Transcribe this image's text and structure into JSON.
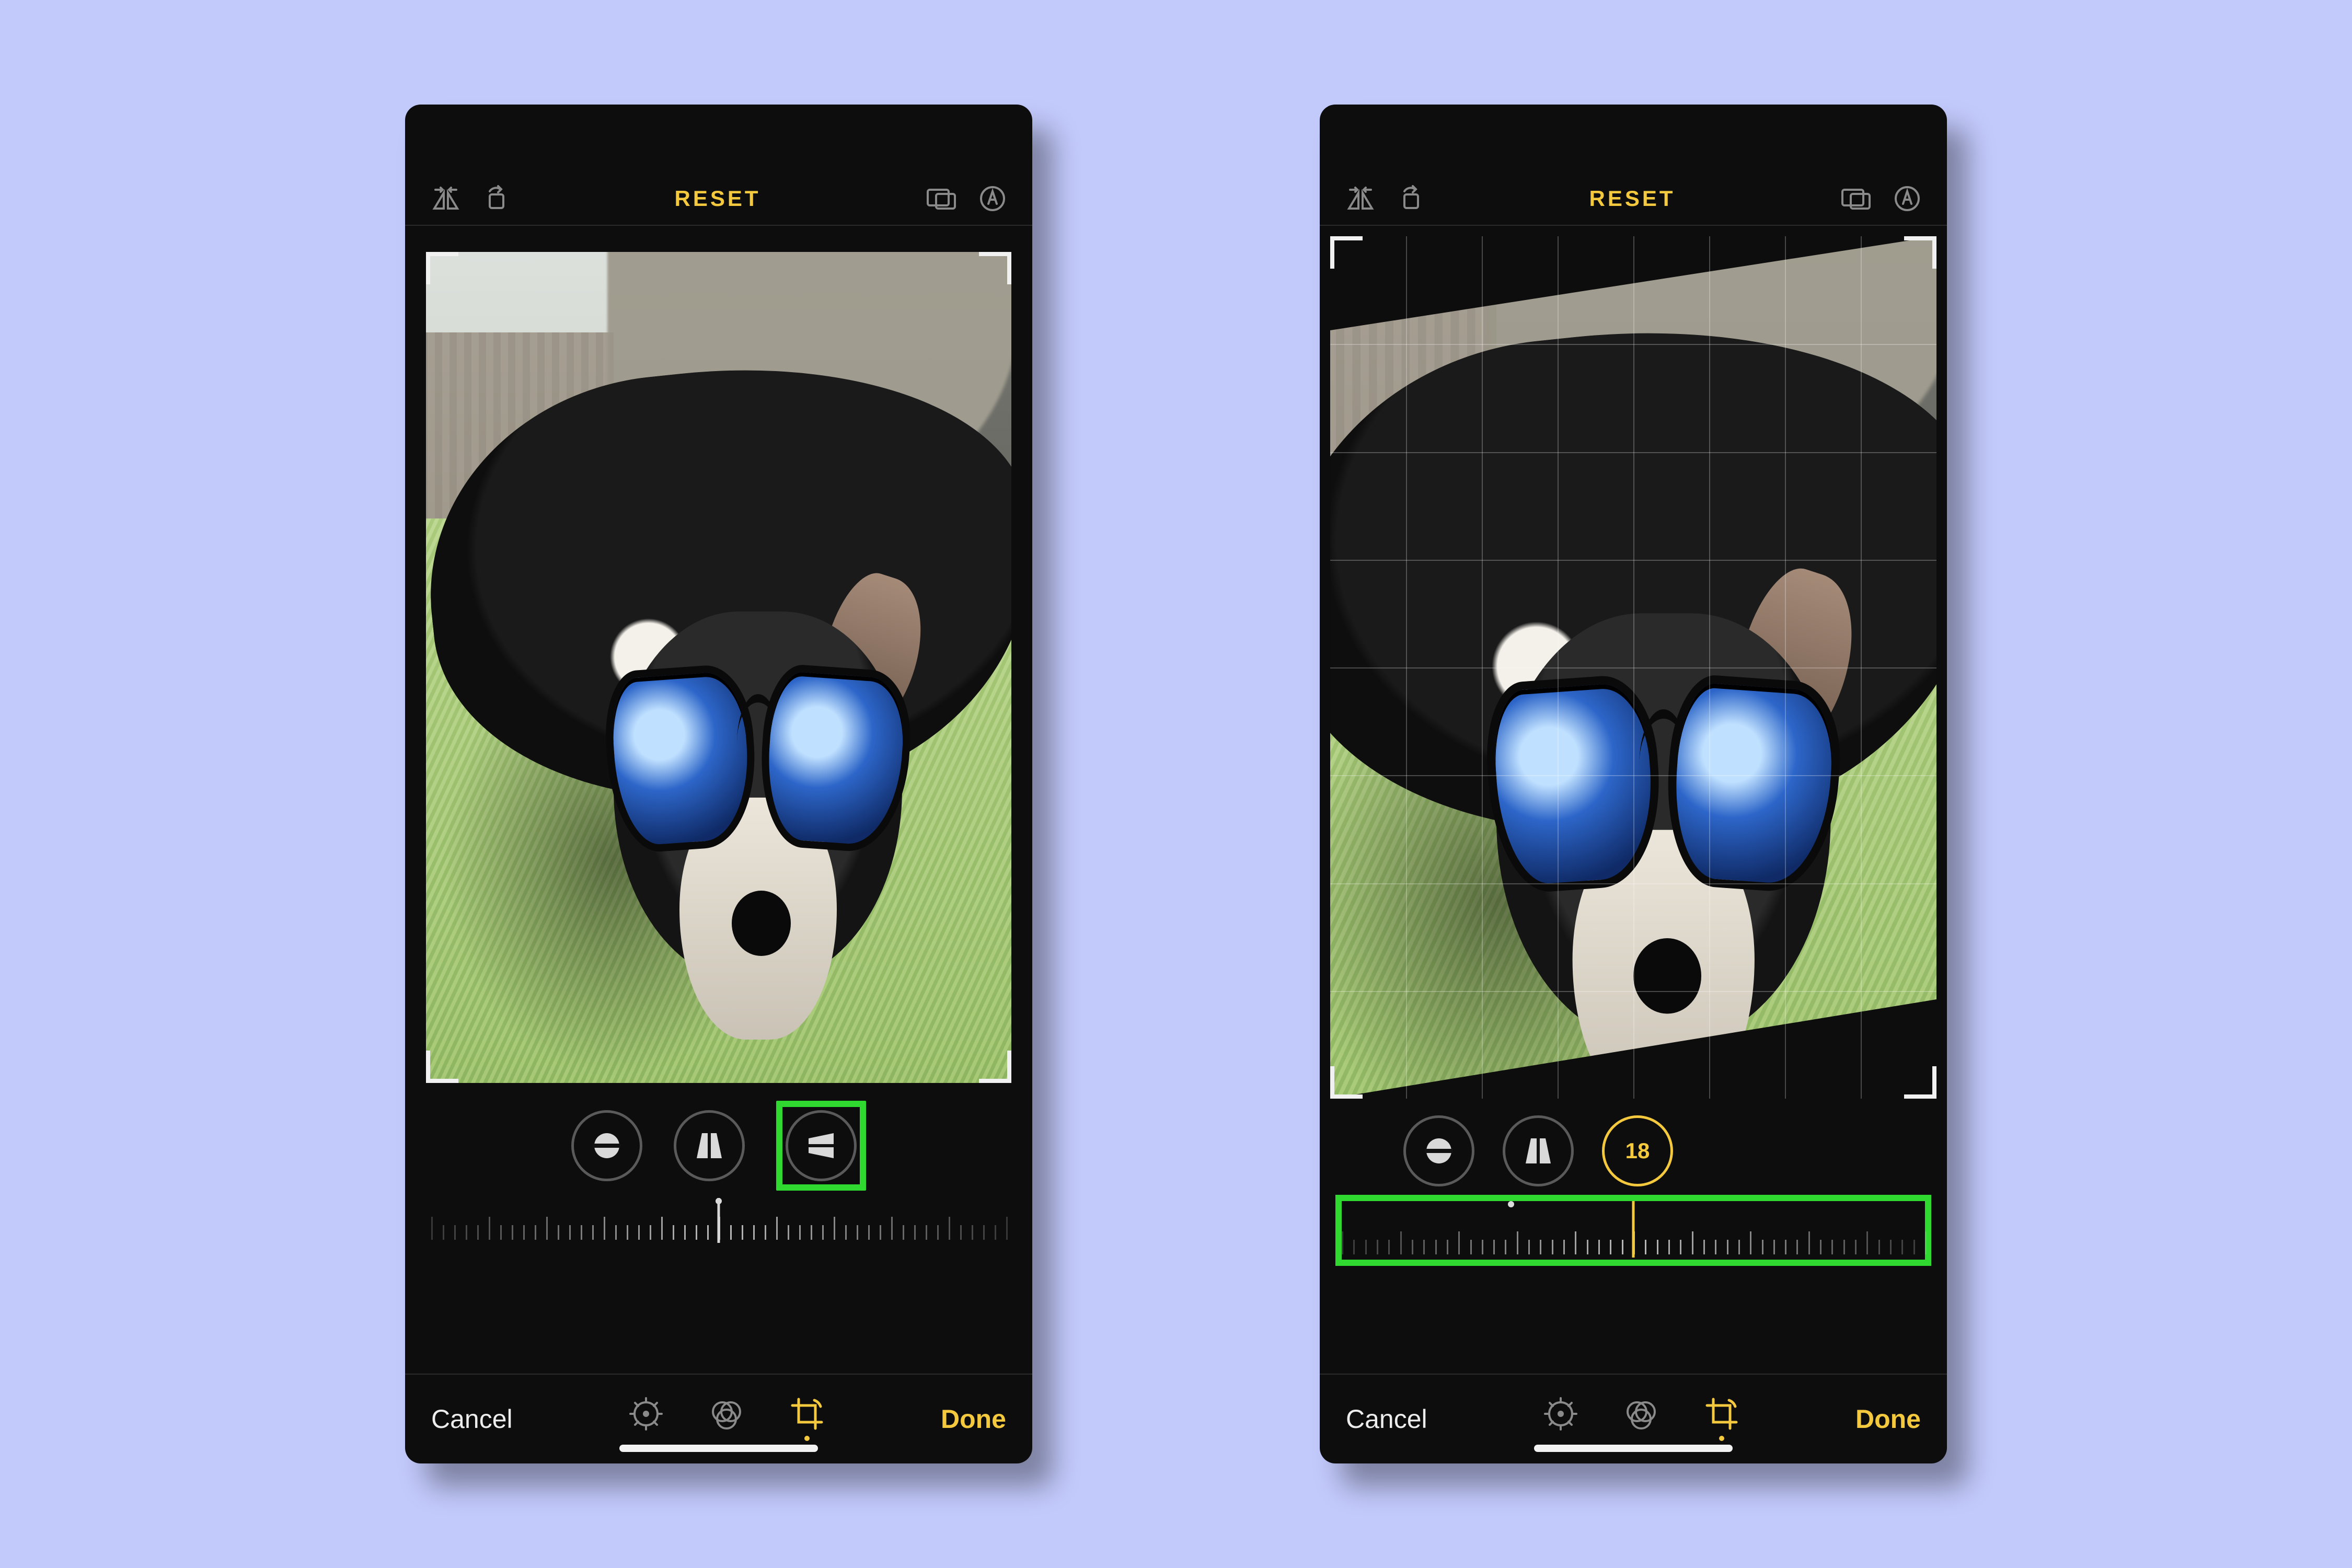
{
  "left": {
    "top": {
      "reset": "RESET"
    },
    "perspective": {
      "tools": [
        "straighten",
        "vertical",
        "horizontal"
      ],
      "highlighted": "horizontal"
    },
    "dial": {
      "value": 0
    },
    "footer": {
      "cancel": "Cancel",
      "done": "Done",
      "active_tab": "crop"
    }
  },
  "right": {
    "top": {
      "reset": "RESET"
    },
    "perspective": {
      "tools": [
        "straighten",
        "vertical",
        "horizontal"
      ],
      "active": "horizontal",
      "value_label": "18"
    },
    "dial": {
      "value": 18,
      "highlighted": true
    },
    "footer": {
      "cancel": "Cancel",
      "done": "Done",
      "active_tab": "crop"
    }
  },
  "image_subject": "black dog wearing blue mirrored sunglasses lying on grass"
}
